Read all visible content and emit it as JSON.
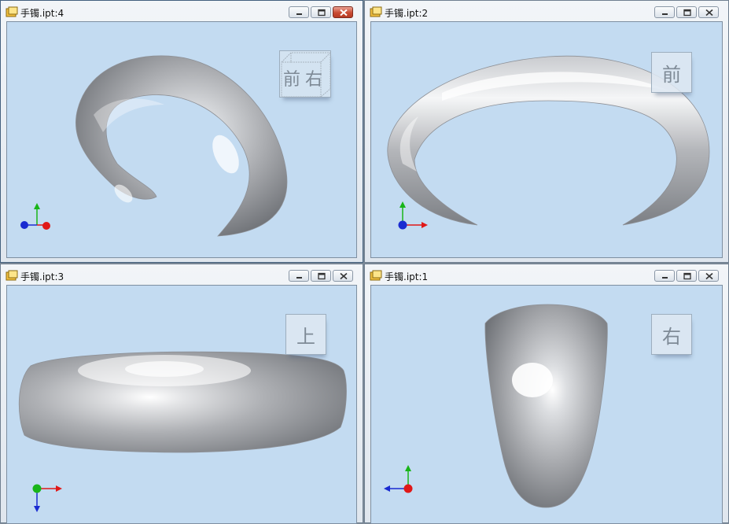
{
  "windows": [
    {
      "id": "w4",
      "title": "手镯.ipt:4",
      "viewcube": {
        "front": "前",
        "right": "右"
      }
    },
    {
      "id": "w2",
      "title": "手镯.ipt:2",
      "viewcube": {
        "face": "前"
      }
    },
    {
      "id": "w3",
      "title": "手镯.ipt:3",
      "viewcube": {
        "face": "上"
      }
    },
    {
      "id": "w1",
      "title": "手镯.ipt:1",
      "viewcube": {
        "face": "右"
      }
    }
  ],
  "icons": [
    "document-icon",
    "minimize-icon",
    "restore-icon",
    "close-icon",
    "axis-triad-icon"
  ],
  "colors": {
    "viewport_bg": "#c3dbf1",
    "model": "#a6a8ac",
    "axis_x": "#e01818",
    "axis_y": "#19b519",
    "axis_z": "#1a2bd1",
    "close_active": "#c94b33"
  }
}
